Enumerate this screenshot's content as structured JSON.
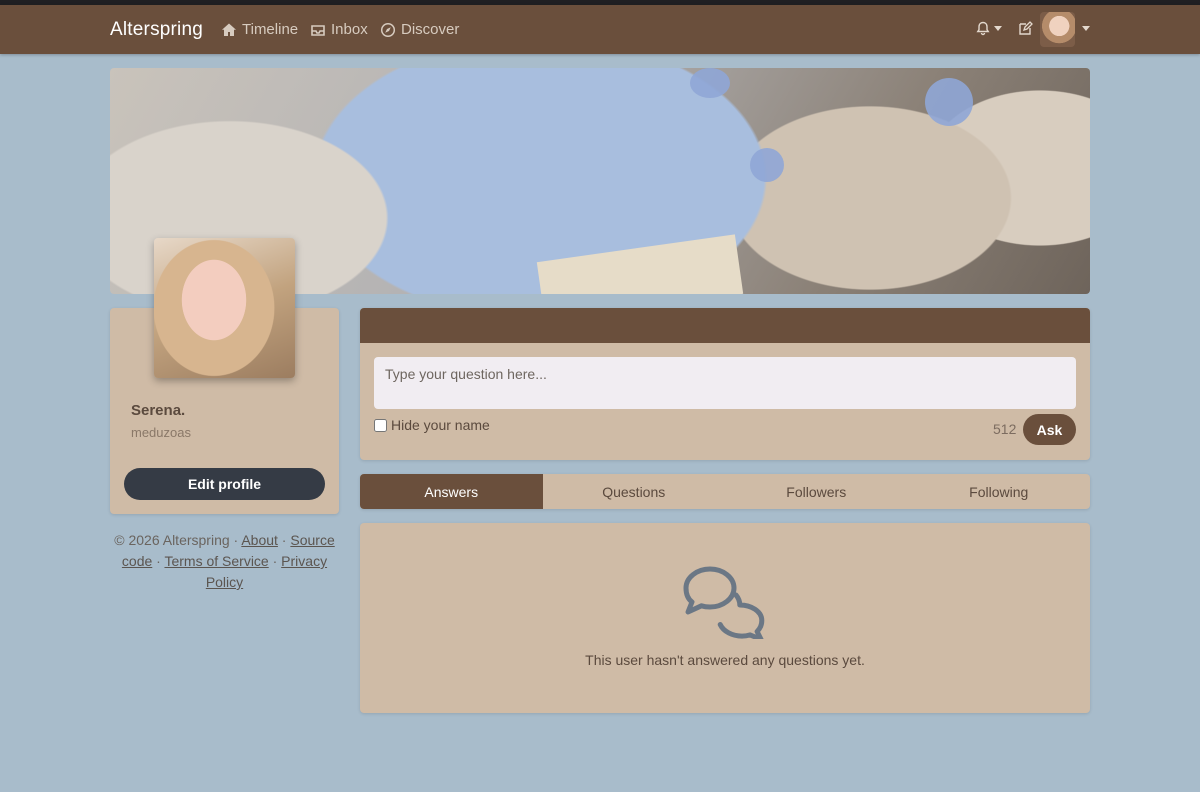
{
  "nav": {
    "brand": "Alterspring",
    "links": [
      {
        "label": "Timeline",
        "icon": "home-icon"
      },
      {
        "label": "Inbox",
        "icon": "inbox-icon"
      },
      {
        "label": "Discover",
        "icon": "compass-icon"
      }
    ]
  },
  "profile": {
    "display_name": "Serena.",
    "screen_name": "meduzoas",
    "edit_label": "Edit profile"
  },
  "footer": {
    "copyright": "© 2026 Alterspring ·",
    "about": "About",
    "source": "Source code",
    "tos": "Terms of Service",
    "privacy": "Privacy Policy"
  },
  "ask": {
    "placeholder": "Type your question here...",
    "hide_name_label": "Hide your name",
    "char_count": "512",
    "ask_label": "Ask"
  },
  "tabs": [
    "Answers",
    "Questions",
    "Followers",
    "Following"
  ],
  "empty": {
    "message": "This user hasn't answered any questions yet."
  },
  "colors": {
    "navbar": "#6a4f3c",
    "page_bg": "#a8bccb",
    "card_bg": "#cfbba6",
    "edit_button": "#353b45"
  }
}
